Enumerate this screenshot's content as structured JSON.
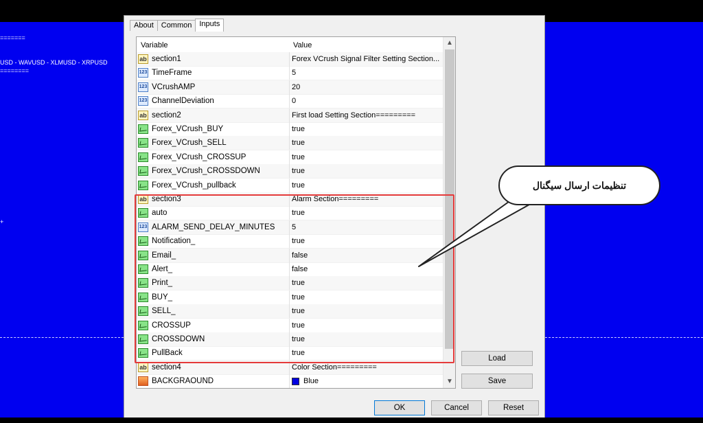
{
  "background": {
    "left_texts": [
      "=======",
      "USD - WAVUSD - XLMUSD - XRPUSD",
      "========",
      "+"
    ]
  },
  "dialog": {
    "tabs": [
      {
        "label": "About",
        "active": false
      },
      {
        "label": "Common",
        "active": false
      },
      {
        "label": "Inputs",
        "active": true
      }
    ],
    "grid": {
      "columns": [
        "Variable",
        "Value"
      ],
      "rows": [
        {
          "icon": "ab",
          "variable": "section1",
          "value": "Forex VCrush Signal Filter  Setting Section..."
        },
        {
          "icon": "num",
          "variable": "TimeFrame",
          "value": "5"
        },
        {
          "icon": "num",
          "variable": "VCrushAMP",
          "value": "20"
        },
        {
          "icon": "num",
          "variable": "ChannelDeviation",
          "value": "0"
        },
        {
          "icon": "ab",
          "variable": "section2",
          "value": "First load Setting Section========="
        },
        {
          "icon": "bool",
          "variable": "Forex_VCrush_BUY",
          "value": "true"
        },
        {
          "icon": "bool",
          "variable": "Forex_VCrush_SELL",
          "value": "true"
        },
        {
          "icon": "bool",
          "variable": "Forex_VCrush_CROSSUP",
          "value": "true"
        },
        {
          "icon": "bool",
          "variable": "Forex_VCrush_CROSSDOWN",
          "value": "true"
        },
        {
          "icon": "bool",
          "variable": "Forex_VCrush_pullback",
          "value": "true"
        },
        {
          "icon": "ab",
          "variable": "section3",
          "value": "Alarm Section========="
        },
        {
          "icon": "bool",
          "variable": "auto",
          "value": "true"
        },
        {
          "icon": "num",
          "variable": "ALARM_SEND_DELAY_MINUTES",
          "value": "5"
        },
        {
          "icon": "bool",
          "variable": "Notification_",
          "value": "true"
        },
        {
          "icon": "bool",
          "variable": "Email_",
          "value": "false"
        },
        {
          "icon": "bool",
          "variable": "Alert_",
          "value": "false"
        },
        {
          "icon": "bool",
          "variable": "Print_",
          "value": "true"
        },
        {
          "icon": "bool",
          "variable": "BUY_",
          "value": "true"
        },
        {
          "icon": "bool",
          "variable": "SELL_",
          "value": "true"
        },
        {
          "icon": "bool",
          "variable": "CROSSUP",
          "value": "true"
        },
        {
          "icon": "bool",
          "variable": "CROSSDOWN",
          "value": "true"
        },
        {
          "icon": "bool",
          "variable": "PullBack",
          "value": "true"
        },
        {
          "icon": "ab",
          "variable": "section4",
          "value": "Color Section========="
        },
        {
          "icon": "color",
          "variable": "BACKGRAOUND",
          "value": "Blue",
          "swatch": "#0000e0"
        }
      ]
    },
    "side_buttons": {
      "load": "Load",
      "save": "Save"
    },
    "bottom_buttons": {
      "ok": "OK",
      "cancel": "Cancel",
      "reset": "Reset"
    }
  },
  "callout": {
    "text": "تنظیمات ارسال سیگنال"
  },
  "colors": {
    "chart_bg": "#0000f0",
    "highlight": "#e53a3a"
  }
}
